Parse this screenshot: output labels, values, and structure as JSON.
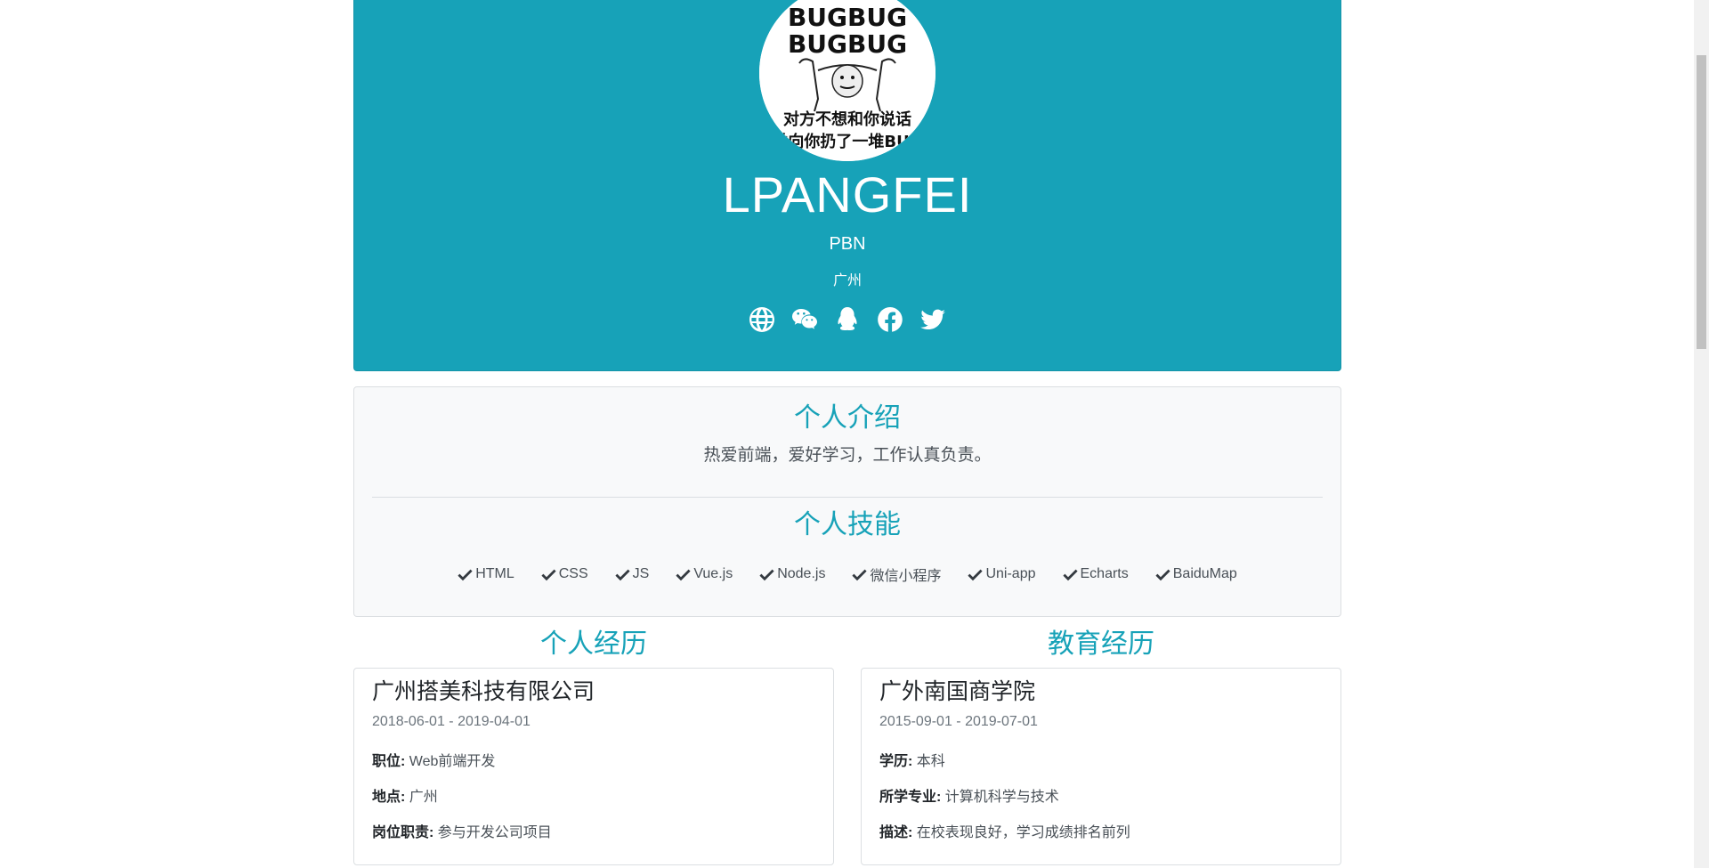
{
  "hero": {
    "name": "LPANGFEI",
    "role": "PBN",
    "city": "广州",
    "avatar_text": [
      "BUG",
      "BUGBUG",
      "BUGBUG",
      "对方不想和你说话",
      "并向你扔了一堆BUG"
    ],
    "socials": [
      {
        "icon": "globe-icon"
      },
      {
        "icon": "wechat-icon"
      },
      {
        "icon": "qq-icon"
      },
      {
        "icon": "facebook-icon"
      },
      {
        "icon": "twitter-icon"
      }
    ]
  },
  "intro": {
    "title": "个人介绍",
    "text": "热爱前端，爱好学习，工作认真负责。"
  },
  "skills": {
    "title": "个人技能",
    "items": [
      "HTML",
      "CSS",
      "JS",
      "Vue.js",
      "Node.js",
      "微信小程序",
      "Uni-app",
      "Echarts",
      "BaiduMap"
    ]
  },
  "experience": {
    "title": "个人经历",
    "company": "广州搭美科技有限公司",
    "date": "2018-06-01 - 2019-04-01",
    "position_label": "职位:",
    "position": "Web前端开发",
    "location_label": "地点:",
    "location": "广州",
    "duty_label": "岗位职责:",
    "duty": "参与开发公司项目"
  },
  "education": {
    "title": "教育经历",
    "school": "广外南国商学院",
    "date": "2015-09-01 - 2019-07-01",
    "degree_label": "学历:",
    "degree": "本科",
    "major_label": "所学专业:",
    "major": "计算机科学与技术",
    "desc_label": "描述:",
    "desc": "在校表现良好，学习成绩排名前列"
  },
  "colors": {
    "accent": "#17a2b8",
    "card_bg": "#f8f9fa"
  }
}
